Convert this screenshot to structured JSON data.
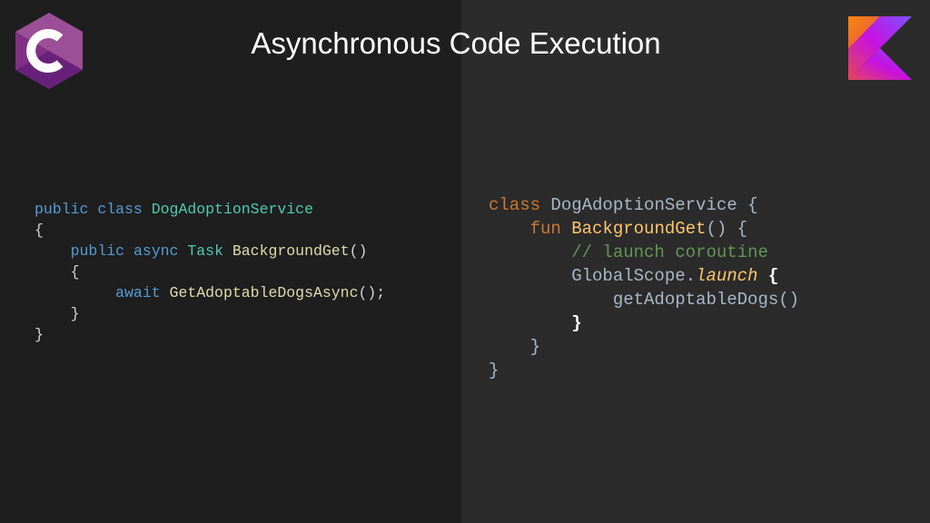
{
  "slide": {
    "title": "Asynchronous Code Execution",
    "left_logo": {
      "icon": "csharp-logo-icon",
      "glyph": "#",
      "colors": [
        "#9b4f96",
        "#68217a",
        "#ffffff"
      ]
    },
    "right_logo": {
      "icon": "kotlin-logo-icon",
      "colors": [
        "#f88909",
        "#e44857",
        "#7f52ff"
      ]
    }
  },
  "csharp": {
    "l1": {
      "kw1": "public",
      "kw2": "class",
      "type": "DogAdoptionService"
    },
    "l2": {
      "pun": "{"
    },
    "l3": {
      "kw1": "public",
      "kw2": "async",
      "type": "Task",
      "fn": "BackgroundGet",
      "pun": "()"
    },
    "l4": {
      "pun": "{"
    },
    "l5": {
      "kw": "await",
      "fn": "GetAdoptableDogsAsync",
      "pun": "();"
    },
    "l6": {
      "pun": "}"
    },
    "l7": {
      "pun": "}"
    }
  },
  "kotlin": {
    "l1": {
      "kw": "class",
      "name": "DogAdoptionService",
      "pun": "{"
    },
    "l2": {
      "kw": "fun",
      "fn": "BackgroundGet",
      "pun": "() {"
    },
    "l3": {
      "comment": "// launch coroutine"
    },
    "l4": {
      "name": "GlobalScope",
      "dot": ".",
      "fn": "launch",
      "pun": "{"
    },
    "l5": {
      "name": "getAdoptableDogs",
      "pun": "()"
    },
    "l6": {
      "pun": "}"
    },
    "l7": {
      "pun": "}"
    },
    "l8": {
      "pun": "}"
    }
  }
}
